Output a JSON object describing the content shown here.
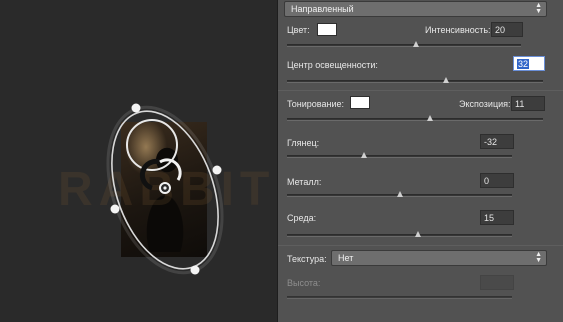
{
  "watermark": "RABBIT HOLE",
  "panel": {
    "light_type": "Направленный",
    "color_label": "Цвет:",
    "intensity_label": "Интенсивность:",
    "intensity_value": "20",
    "intensity_fraction": 0.55,
    "hotspot_label": "Центр освещенности:",
    "hotspot_value": "32",
    "hotspot_fraction": 0.62,
    "toning_label": "Тонирование:",
    "exposure_label": "Экспозиция:",
    "exposure_value": "11",
    "exposure_fraction": 0.56,
    "gloss_label": "Глянец:",
    "gloss_value": "-32",
    "gloss_fraction": 0.34,
    "metallic_label": "Металл:",
    "metallic_value": "0",
    "metallic_fraction": 0.5,
    "ambience_label": "Среда:",
    "ambience_value": "15",
    "ambience_fraction": 0.58,
    "texture_label": "Текстура:",
    "texture_value": "Нет",
    "height_label": "Высота:",
    "height_fraction": 0.5,
    "colors": {
      "light_color": "#ffffff",
      "toning_color": "#ffffff"
    }
  }
}
